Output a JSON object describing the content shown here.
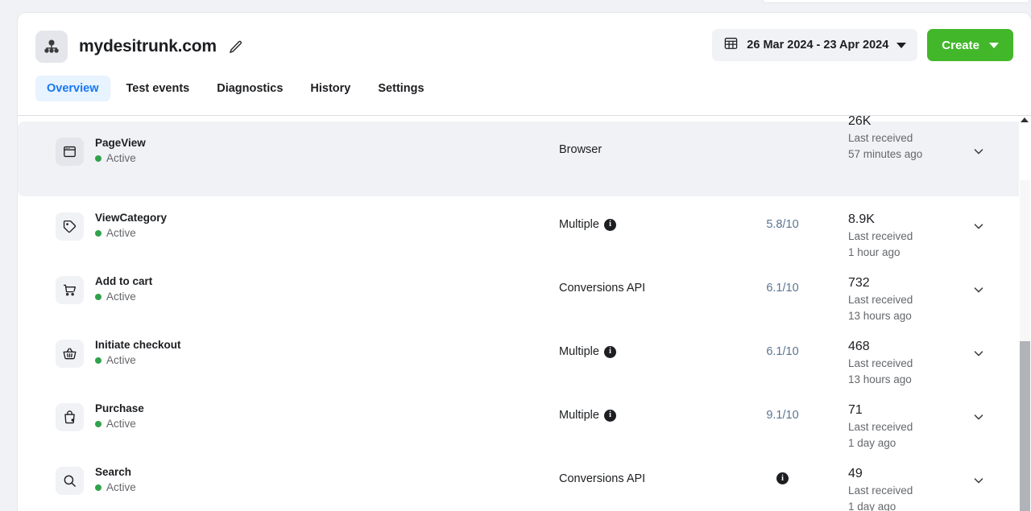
{
  "header": {
    "account_icon": "dataset-node-icon",
    "site_title": "mydesitrunk.com",
    "edit_icon": "pencil-icon",
    "date_range": {
      "calendar_icon": "calendar-icon",
      "value": "26 Mar 2024 - 23 Apr 2024",
      "caret_icon": "caret-down-icon"
    },
    "create_button": {
      "label": "Create",
      "caret_icon": "caret-down-icon",
      "color": "#42b72a"
    }
  },
  "tabs": [
    {
      "label": "Overview",
      "active": true
    },
    {
      "label": "Test events",
      "active": false
    },
    {
      "label": "Diagnostics",
      "active": false
    },
    {
      "label": "History",
      "active": false
    },
    {
      "label": "Settings",
      "active": false
    }
  ],
  "colors": {
    "accent_blue": "#1877f2",
    "active_tab_bg": "#e7f3ff",
    "status_green": "#31a24c",
    "create_green": "#42b72a",
    "score_link": "#5b7391",
    "row_highlight": "#f0f2f5"
  },
  "events": [
    {
      "icon": "browser-window-icon",
      "name": "PageView",
      "status": "Active",
      "connection": "Browser",
      "has_info_icon": false,
      "score": "",
      "count": "26K",
      "last_received_label": "Last received",
      "last_received_time": "57 minutes ago",
      "chevron_icon": "chevron-down-icon",
      "highlighted": true,
      "clipped_top": true
    },
    {
      "icon": "tag-icon",
      "name": "ViewCategory",
      "status": "Active",
      "connection": "Multiple",
      "has_info_icon": true,
      "score": "5.8/10",
      "count": "8.9K",
      "last_received_label": "Last received",
      "last_received_time": "1 hour ago",
      "chevron_icon": "chevron-down-icon",
      "highlighted": false,
      "clipped_top": false
    },
    {
      "icon": "shopping-cart-icon",
      "name": "Add to cart",
      "status": "Active",
      "connection": "Conversions API",
      "has_info_icon": false,
      "score": "6.1/10",
      "count": "732",
      "last_received_label": "Last received",
      "last_received_time": "13 hours ago",
      "chevron_icon": "chevron-down-icon",
      "highlighted": false,
      "clipped_top": false
    },
    {
      "icon": "shopping-basket-icon",
      "name": "Initiate checkout",
      "status": "Active",
      "connection": "Multiple",
      "has_info_icon": true,
      "score": "6.1/10",
      "count": "468",
      "last_received_label": "Last received",
      "last_received_time": "13 hours ago",
      "chevron_icon": "chevron-down-icon",
      "highlighted": false,
      "clipped_top": false
    },
    {
      "icon": "shopping-bag-icon",
      "name": "Purchase",
      "status": "Active",
      "connection": "Multiple",
      "has_info_icon": true,
      "score": "9.1/10",
      "count": "71",
      "last_received_label": "Last received",
      "last_received_time": "1 day ago",
      "chevron_icon": "chevron-down-icon",
      "highlighted": false,
      "clipped_top": false
    },
    {
      "icon": "magnifier-icon",
      "name": "Search",
      "status": "Active",
      "connection": "Conversions API",
      "has_info_icon": false,
      "score": "",
      "score_info_icon": true,
      "count": "49",
      "last_received_label": "Last received",
      "last_received_time": "1 day ago",
      "chevron_icon": "chevron-down-icon",
      "highlighted": false,
      "clipped_top": false
    }
  ],
  "scrollbar": {
    "up_arrow_icon": "scroll-up-arrow-icon",
    "thumb": "scrollbar-thumb"
  }
}
